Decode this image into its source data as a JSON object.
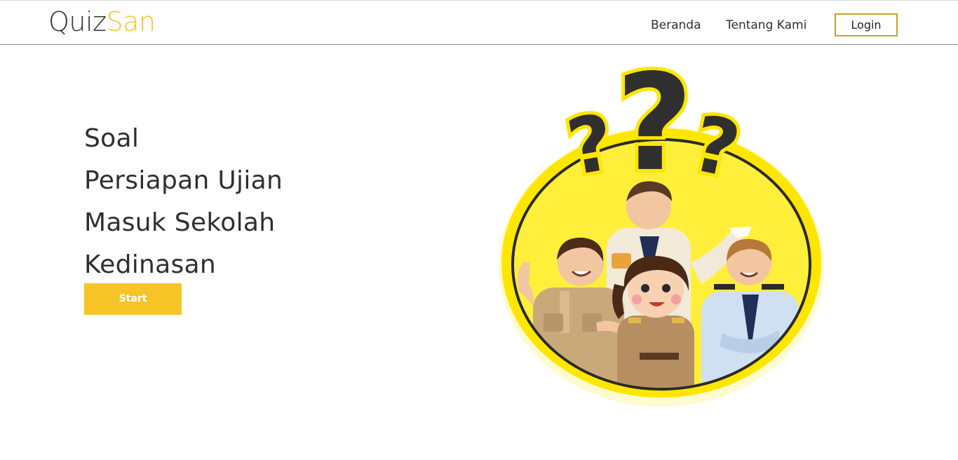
{
  "header": {
    "logo_part1": "Quiz",
    "logo_part2": "San",
    "nav": [
      {
        "label": "Beranda"
      },
      {
        "label": "Tentang Kami"
      }
    ],
    "login_label": "Login"
  },
  "hero": {
    "lines": [
      "Soal",
      "Persiapan Ujian",
      "Masuk Sekolah",
      "Kedinasan"
    ],
    "start_label": "Start"
  },
  "colors": {
    "accent": "#f7c428",
    "login_border": "#c9a227",
    "text": "#2f2f2f",
    "illustration_circle": "#ffe600"
  },
  "illustration": {
    "icon": "question-marks-with-uniformed-officials"
  }
}
